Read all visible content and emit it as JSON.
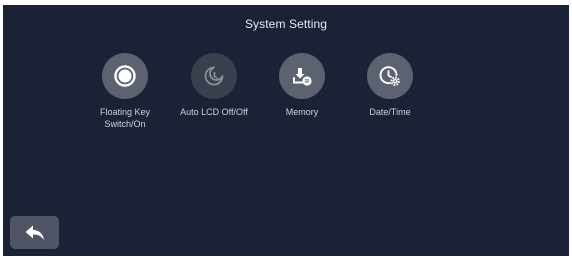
{
  "screen": {
    "title": "System Setting"
  },
  "settings": {
    "items": [
      {
        "label": "Floating Key\nSwitch/On",
        "icon": "toggle-ring-icon",
        "state": "enabled"
      },
      {
        "label": "Auto LCD Off/Off",
        "icon": "moon-clock-icon",
        "state": "disabled"
      },
      {
        "label": "Memory",
        "icon": "memory-download-icon",
        "state": "enabled"
      },
      {
        "label": "Date/Time",
        "icon": "clock-gear-icon",
        "state": "enabled"
      }
    ]
  },
  "navigation": {
    "back_icon": "back-arrow-icon"
  },
  "colors": {
    "background": "#1c2236",
    "button": "#5d6271",
    "button_disabled": "#3a3f4e",
    "text": "#e8e9ee"
  }
}
